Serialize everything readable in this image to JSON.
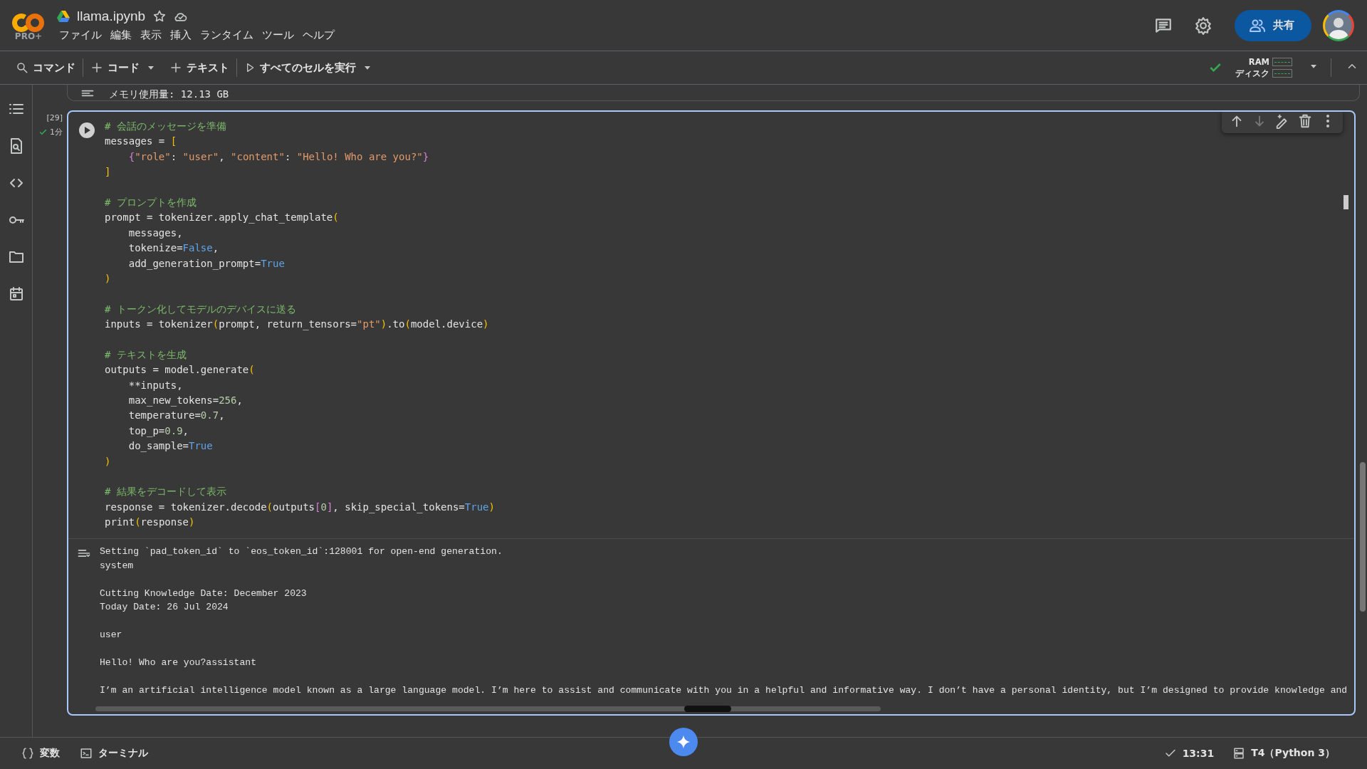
{
  "header": {
    "logo_badge": "PRO+",
    "file_name": "llama.ipynb",
    "menu": [
      "ファイル",
      "編集",
      "表示",
      "挿入",
      "ランタイム",
      "ツール",
      "ヘルプ"
    ],
    "share_button": "共有"
  },
  "toolbar": {
    "command": "コマンド",
    "add_code": "コード",
    "add_text": "テキスト",
    "run_all": "すべてのセルを実行",
    "connected": true,
    "ram_label": "RAM",
    "disk_label": "ディスク"
  },
  "previous_output": "メモリ使用量: 12.13 GB",
  "cell": {
    "execution_count": "[29]",
    "status": "1分",
    "code_lines": [
      {
        "kind": "code",
        "tokens": [
          {
            "kind": "comment",
            "text": "# 会話のメッセージを準備"
          }
        ]
      },
      {
        "kind": "code",
        "tokens": [
          {
            "kind": "plain",
            "text": "messages = "
          },
          {
            "kind": "bracket",
            "text": "["
          }
        ]
      },
      {
        "kind": "code",
        "tokens": [
          {
            "kind": "brace",
            "text": "    {"
          },
          {
            "kind": "string",
            "text": "\"role\""
          },
          {
            "kind": "plain",
            "text": ": "
          },
          {
            "kind": "string",
            "text": "\"user\""
          },
          {
            "kind": "plain",
            "text": ", "
          },
          {
            "kind": "string",
            "text": "\"content\""
          },
          {
            "kind": "plain",
            "text": ": "
          },
          {
            "kind": "string",
            "text": "\"Hello! Who are you?\""
          },
          {
            "kind": "brace",
            "text": "}"
          }
        ]
      },
      {
        "kind": "code",
        "tokens": [
          {
            "kind": "bracket",
            "text": "]"
          }
        ]
      },
      {
        "kind": "blank"
      },
      {
        "kind": "code",
        "tokens": [
          {
            "kind": "comment",
            "text": "# プロンプトを作成"
          }
        ]
      },
      {
        "kind": "code",
        "tokens": [
          {
            "kind": "plain",
            "text": "prompt = tokenizer.apply_chat_template"
          },
          {
            "kind": "bracket",
            "text": "("
          }
        ]
      },
      {
        "kind": "code",
        "tokens": [
          {
            "kind": "plain",
            "text": "    messages,"
          }
        ]
      },
      {
        "kind": "code",
        "tokens": [
          {
            "kind": "plain",
            "text": "    tokenize="
          },
          {
            "kind": "keyword",
            "text": "False"
          },
          {
            "kind": "plain",
            "text": ","
          }
        ]
      },
      {
        "kind": "code",
        "tokens": [
          {
            "kind": "plain",
            "text": "    add_generation_prompt="
          },
          {
            "kind": "keyword",
            "text": "True"
          }
        ]
      },
      {
        "kind": "code",
        "tokens": [
          {
            "kind": "bracket",
            "text": ")"
          }
        ]
      },
      {
        "kind": "blank"
      },
      {
        "kind": "code",
        "tokens": [
          {
            "kind": "comment",
            "text": "# トークン化してモデルのデバイスに送る"
          }
        ]
      },
      {
        "kind": "code",
        "tokens": [
          {
            "kind": "plain",
            "text": "inputs = tokenizer"
          },
          {
            "kind": "bracket",
            "text": "("
          },
          {
            "kind": "plain",
            "text": "prompt, return_tensors="
          },
          {
            "kind": "string",
            "text": "\"pt\""
          },
          {
            "kind": "bracket",
            "text": ")"
          },
          {
            "kind": "plain",
            "text": ".to"
          },
          {
            "kind": "bracket",
            "text": "("
          },
          {
            "kind": "plain",
            "text": "model.device"
          },
          {
            "kind": "bracket",
            "text": ")"
          }
        ]
      },
      {
        "kind": "blank"
      },
      {
        "kind": "code",
        "tokens": [
          {
            "kind": "comment",
            "text": "# テキストを生成"
          }
        ]
      },
      {
        "kind": "code",
        "tokens": [
          {
            "kind": "plain",
            "text": "outputs = model.generate"
          },
          {
            "kind": "bracket",
            "text": "("
          }
        ]
      },
      {
        "kind": "code",
        "tokens": [
          {
            "kind": "plain",
            "text": "    **inputs,"
          }
        ]
      },
      {
        "kind": "code",
        "tokens": [
          {
            "kind": "plain",
            "text": "    max_new_tokens="
          },
          {
            "kind": "number",
            "text": "256"
          },
          {
            "kind": "plain",
            "text": ","
          }
        ]
      },
      {
        "kind": "code",
        "tokens": [
          {
            "kind": "plain",
            "text": "    temperature="
          },
          {
            "kind": "number",
            "text": "0.7"
          },
          {
            "kind": "plain",
            "text": ","
          }
        ]
      },
      {
        "kind": "code",
        "tokens": [
          {
            "kind": "plain",
            "text": "    top_p="
          },
          {
            "kind": "number",
            "text": "0.9"
          },
          {
            "kind": "plain",
            "text": ","
          }
        ]
      },
      {
        "kind": "code",
        "tokens": [
          {
            "kind": "plain",
            "text": "    do_sample="
          },
          {
            "kind": "keyword",
            "text": "True"
          }
        ]
      },
      {
        "kind": "code",
        "tokens": [
          {
            "kind": "bracket",
            "text": ")"
          }
        ]
      },
      {
        "kind": "blank"
      },
      {
        "kind": "code",
        "tokens": [
          {
            "kind": "comment",
            "text": "# 結果をデコードして表示"
          }
        ]
      },
      {
        "kind": "code",
        "tokens": [
          {
            "kind": "plain",
            "text": "response = tokenizer.decode"
          },
          {
            "kind": "bracket",
            "text": "("
          },
          {
            "kind": "plain",
            "text": "outputs"
          },
          {
            "kind": "brace",
            "text": "["
          },
          {
            "kind": "number",
            "text": "0"
          },
          {
            "kind": "brace",
            "text": "]"
          },
          {
            "kind": "plain",
            "text": ", skip_special_tokens="
          },
          {
            "kind": "keyword",
            "text": "True"
          },
          {
            "kind": "bracket",
            "text": ")"
          }
        ]
      },
      {
        "kind": "code",
        "tokens": [
          {
            "kind": "plain",
            "text": "print"
          },
          {
            "kind": "bracket",
            "text": "("
          },
          {
            "kind": "plain",
            "text": "response"
          },
          {
            "kind": "bracket",
            "text": ")"
          }
        ]
      }
    ],
    "output_lines": [
      {
        "kind": "line",
        "text": "Setting `pad_token_id` to `eos_token_id`:128001 for open-end generation."
      },
      {
        "kind": "line",
        "text": "system"
      },
      {
        "kind": "blank"
      },
      {
        "kind": "line",
        "text": "Cutting Knowledge Date: December 2023"
      },
      {
        "kind": "line",
        "text": "Today Date: 26 Jul 2024"
      },
      {
        "kind": "blank"
      },
      {
        "kind": "line",
        "text": "user"
      },
      {
        "kind": "blank"
      },
      {
        "kind": "line",
        "text": "Hello! Who are you?assistant"
      },
      {
        "kind": "blank"
      },
      {
        "kind": "line",
        "text": "I’m an artificial intelligence model known as a large language model. I’m here to assist and communicate with you in a helpful and informative way. I don’t have a personal identity, but I’m designed to provide knowledge and"
      }
    ]
  },
  "status_bar": {
    "variables": "変数",
    "terminal": "ターミナル",
    "time": "13:31",
    "runtime": "T4（Python 3）"
  }
}
